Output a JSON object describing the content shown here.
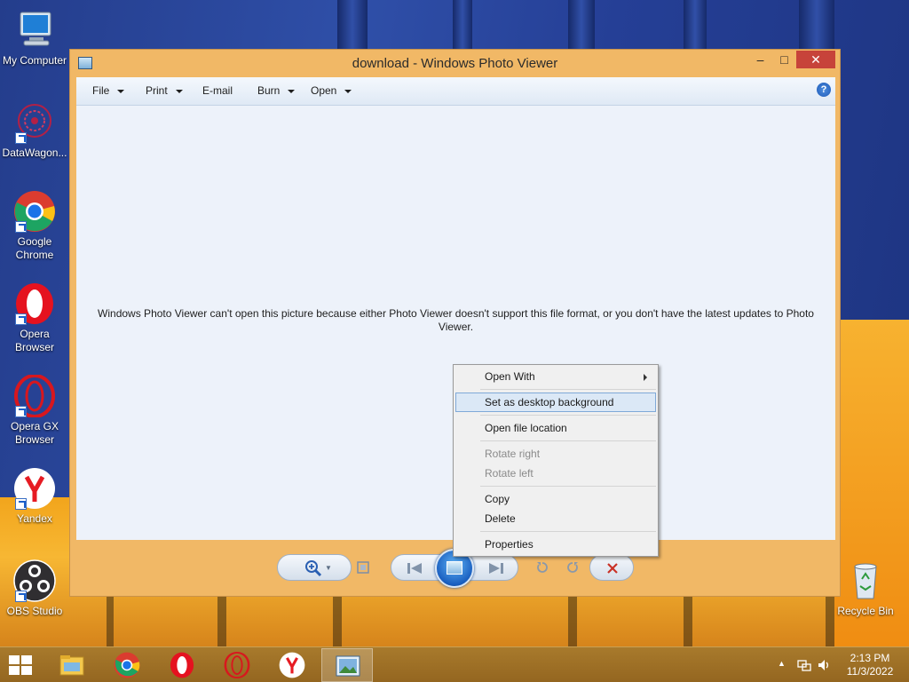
{
  "desktop": {
    "icons": [
      {
        "label": "My Computer",
        "icon": "computer-icon"
      },
      {
        "label": "DataWagon...",
        "icon": "datawagon-icon"
      },
      {
        "label": "Google Chrome",
        "icon": "chrome-icon"
      },
      {
        "label": "Opera Browser",
        "icon": "opera-icon"
      },
      {
        "label": "Opera GX Browser",
        "icon": "opera-gx-icon"
      },
      {
        "label": "Yandex",
        "icon": "yandex-icon"
      },
      {
        "label": "OBS Studio",
        "icon": "obs-icon"
      },
      {
        "label": "Recycle Bin",
        "icon": "recycle-bin-icon"
      }
    ]
  },
  "window": {
    "title": "download - Windows Photo Viewer",
    "controls": {
      "minimize": "–",
      "maximize": "□",
      "close": "✕"
    },
    "menu": [
      {
        "label": "File",
        "has_caret": true
      },
      {
        "label": "Print",
        "has_caret": true
      },
      {
        "label": "E-mail",
        "has_caret": false
      },
      {
        "label": "Burn",
        "has_caret": true
      },
      {
        "label": "Open",
        "has_caret": true
      }
    ],
    "help": "?",
    "error_message": "Windows Photo Viewer can't open this picture because either Photo Viewer doesn't support this file format, or you don't have the latest updates to Photo Viewer.",
    "toolbar": {
      "zoom": "zoom-icon",
      "actual_size": "fit-window-icon",
      "previous": "previous-icon",
      "slideshow": "slideshow-icon",
      "next": "next-icon",
      "rotate_ccw": "rotate-left-icon",
      "rotate_cw": "rotate-right-icon",
      "delete": "delete-icon"
    }
  },
  "context_menu": {
    "items": [
      {
        "label": "Open With",
        "submenu": true,
        "disabled": false,
        "highlighted": false
      },
      {
        "label": "Set as desktop background",
        "submenu": false,
        "disabled": false,
        "highlighted": true
      },
      {
        "label": "Open file location",
        "submenu": false,
        "disabled": false,
        "highlighted": false
      },
      {
        "label": "Rotate right",
        "submenu": false,
        "disabled": true,
        "highlighted": false
      },
      {
        "label": "Rotate left",
        "submenu": false,
        "disabled": true,
        "highlighted": false
      },
      {
        "label": "Copy",
        "submenu": false,
        "disabled": false,
        "highlighted": false
      },
      {
        "label": "Delete",
        "submenu": false,
        "disabled": false,
        "highlighted": false
      },
      {
        "label": "Properties",
        "submenu": false,
        "disabled": false,
        "highlighted": false
      }
    ]
  },
  "taskbar": {
    "apps": [
      "file-explorer-icon",
      "chrome-icon",
      "opera-icon",
      "opera-gx-icon",
      "yandex-icon",
      "photo-viewer-icon"
    ],
    "active_app": "photo-viewer-icon",
    "clock": {
      "time": "2:13 PM",
      "date": "11/3/2022"
    }
  },
  "colors": {
    "window_frame": "#f1b866",
    "close_button": "#c7433a",
    "highlight": "#dbe8f6"
  }
}
